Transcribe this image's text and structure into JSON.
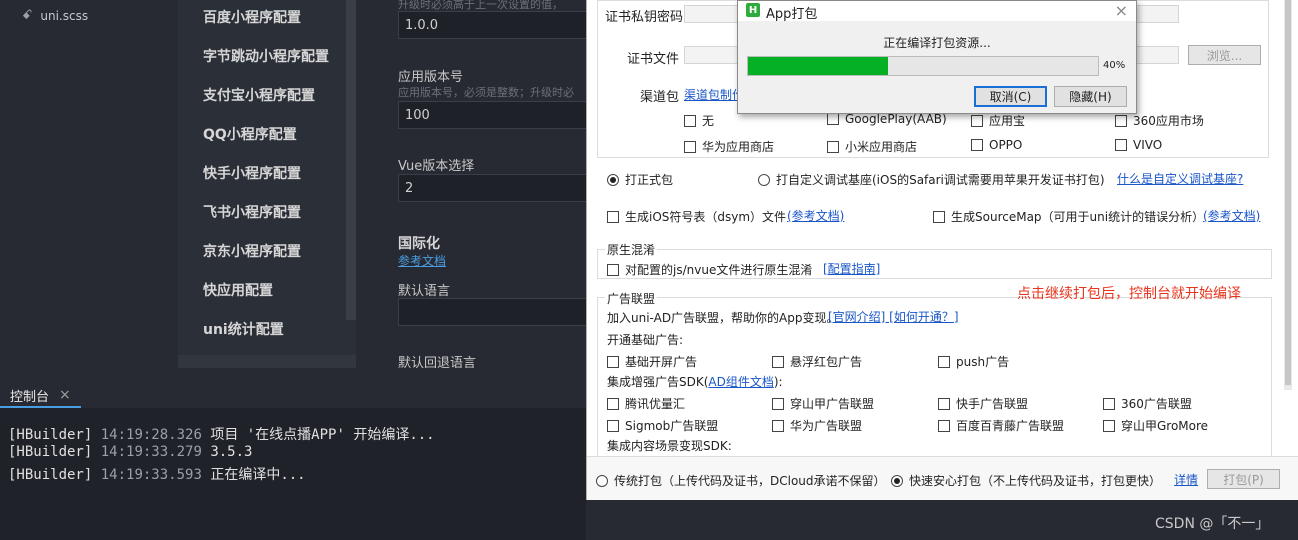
{
  "file_tree": {
    "file": "uni.scss",
    "file_icon": "style-file-icon"
  },
  "settings_nav": {
    "items": [
      "百度小程序配置",
      "字节跳动小程序配置",
      "支付宝小程序配置",
      "QQ小程序配置",
      "快手小程序配置",
      "飞书小程序配置",
      "京东小程序配置",
      "快应用配置",
      "uni统计配置"
    ]
  },
  "form": {
    "top_hint": "升级时必须高于上一次设置的值，",
    "version_name_value": "1.0.0",
    "version_code_label": "应用版本号",
    "version_code_hint": "应用版本号，必须是整数；升级时必",
    "version_code_value": "100",
    "vue_label": "Vue版本选择",
    "vue_value": "2",
    "i18n_heading": "国际化",
    "i18n_link": "参考文档",
    "default_lang_label": "默认语言",
    "fallback_lang_label": "默认回退语言"
  },
  "console": {
    "tab_label": "控制台",
    "close_glyph": "×",
    "lines": [
      {
        "tag": "[HBuilder]",
        "ts": "14:19:28.326",
        "msg": "项目 '在线点播APP' 开始编译..."
      },
      {
        "tag": "[HBuilder]",
        "ts": "14:19:33.279",
        "msg": "3.5.3"
      },
      {
        "tag": "[HBuilder]",
        "ts": "14:19:33.593",
        "msg": "正在编译中..."
      }
    ]
  },
  "pack_dialog": {
    "cert_password_label": "证书私钥密码",
    "cert_file_label": "证书文件",
    "browse_button": "浏览...",
    "channel_label": "渠道包",
    "channel_link": "渠道包制作",
    "channels": [
      "无",
      "GooglePlay(AAB)",
      "应用宝",
      "360应用市场",
      "华为应用商店",
      "小米应用商店",
      "OPPO",
      "VIVO"
    ],
    "pack_formal": "打正式包",
    "pack_custom_base": "打自定义调试基座(iOS的Safari调试需要用苹果开发证书打包)",
    "custom_base_link": "什么是自定义调试基座?",
    "gen_dsym": "生成iOS符号表（dsym）文件",
    "ref_doc_link": "(参考文档)",
    "gen_sourcemap": "生成SourceMap（可用于uni统计的错误分析）",
    "native_obfuscation_title": "原生混淆",
    "native_obfuscation_check": "对配置的js/nvue文件进行原生混淆",
    "obfuscation_guide_link": "[配置指南]",
    "ad_title": "广告联盟",
    "ad_intro": "加入uni-AD广告联盟，帮助你的App变现。",
    "ad_intro_link": "[官网介绍] [如何开通？]",
    "ad_basic_label": "开通基础广告:",
    "ad_basic": [
      "基础开屏广告",
      "悬浮红包广告",
      "push广告"
    ],
    "ad_sdk_label_pre": "集成增强广告SDK(",
    "ad_sdk_link": "AD组件文档",
    "ad_sdk_label_post": "):",
    "ad_sdk": [
      "腾讯优量汇",
      "穿山甲广告联盟",
      "快手广告联盟",
      "360广告联盟",
      "Sigmob广告联盟",
      "华为广告联盟",
      "百度百青藤广告联盟",
      "穿山甲GroMore"
    ],
    "ad_content_label": "集成内容场景变现SDK:",
    "footer": {
      "traditional": "传统打包（上传代码及证书，DCloud承诺不保留）",
      "fast_safe": "快速安心打包（不上传代码及证书，打包更快）",
      "detail_link": "详情",
      "pack_button": "打包(P)"
    }
  },
  "annotation": "点击继续打包后，控制台就开始编译",
  "progress_dialog": {
    "title": "App打包",
    "logo_letter": "H",
    "close_glyph": "×",
    "status": "正在编译打包资源...",
    "progress": 40,
    "percent_text": "40%",
    "cancel_button": "取消(C)",
    "hide_button": "隐藏(H)",
    "fill_color": "#06b025"
  },
  "watermark": "CSDN @「不一」"
}
